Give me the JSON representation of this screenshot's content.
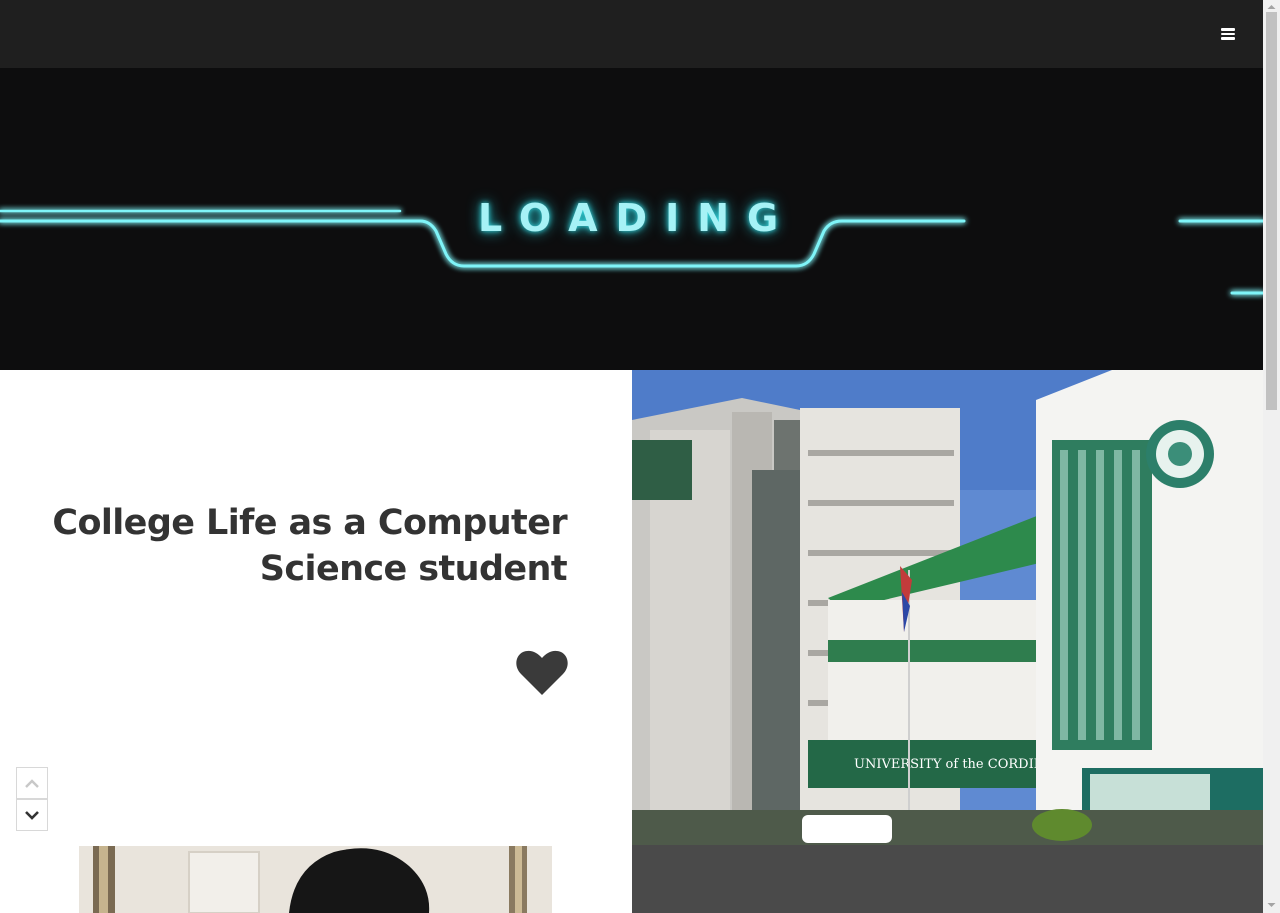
{
  "banner": {
    "loading_text": "LOADING"
  },
  "post": {
    "title": "College Life as a Computer Science student"
  },
  "photo": {
    "sign_text": "UNIVERSITY of the CORDILLERAS"
  },
  "icons": {
    "menu": "hamburger-menu-icon",
    "favorite": "heart-icon",
    "scroll_up": "chevron-up-icon",
    "scroll_down": "chevron-down-icon"
  },
  "colors": {
    "topbar": "#1f1f1f",
    "hero_background": "#0d0d0e",
    "neon_accent": "#39e0e8",
    "title_text": "#333333"
  }
}
